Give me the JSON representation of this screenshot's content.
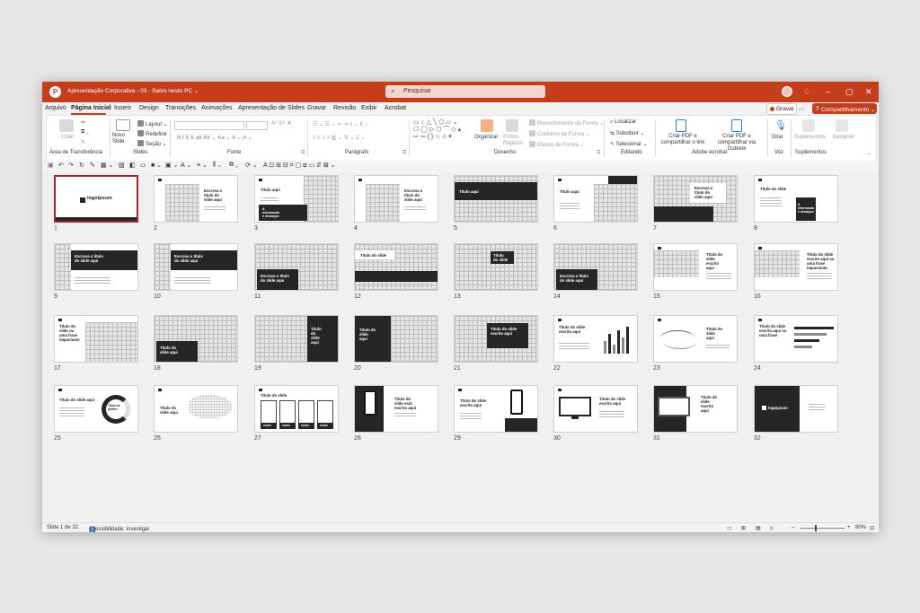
{
  "titlebar": {
    "doc_title": "Apresentação Corporativa - 03  ·  Salvo neste PC ⌄",
    "search_placeholder": "Pesquisar",
    "accent": "#c43e1c"
  },
  "tabs": [
    "Arquivo",
    "Página Inicial",
    "Inserir",
    "Design",
    "Transições",
    "Animações",
    "Apresentação de Slides",
    "Gravar",
    "Revisão",
    "Exibir",
    "Acrobat"
  ],
  "tab_actions": {
    "record": "Gravar",
    "share": "Compartilhamento ⌄"
  },
  "ribbon": {
    "clipboard": {
      "paste": "Colar",
      "label": "Área de Transferência"
    },
    "slides": {
      "new_slide": "Novo Slide",
      "layout": "Layout ⌄",
      "reset": "Redefinir",
      "section": "Seção ⌄",
      "label": "Slides"
    },
    "font": {
      "label": "Fonte",
      "buttons": "N  I  S  S  ab  AV ⌄  Aa ⌄  A ⌄  A ⌄"
    },
    "paragraph": {
      "label": "Parágrafo"
    },
    "drawing": {
      "arrange": "Organizar",
      "quick_styles": "Estilos Rápidos",
      "fill": "Preenchimento da Forma ⌄",
      "outline": "Contorno da Forma ⌄",
      "effects": "Efeitos de Forma ⌄",
      "label": "Desenho"
    },
    "editing": {
      "find": "Localizar",
      "replace": "Substituir ⌄",
      "select": "Selecionar ⌄",
      "label": "Editando"
    },
    "acrobat": {
      "create_share": "Criar PDF e compartilhar o link",
      "create_outlook": "Criar PDF e compartilhar via Outlook",
      "label": "Adobe Acrobat"
    },
    "voice": {
      "dictate": "Ditar",
      "label": "Voz"
    },
    "addins": {
      "suggestions": "Suplementos",
      "designer": "Designer",
      "label": "Suplementos"
    }
  },
  "slides": [
    {
      "n": "1",
      "kind": "cover",
      "logo": "logoipsum"
    },
    {
      "n": "2",
      "kind": "grid-left",
      "title": "Escreva o\ntítulo do\nslide aqui"
    },
    {
      "n": "3",
      "kind": "grid-right-dark",
      "title": "Título aqui",
      "caption": "A\ninformação\né destaque"
    },
    {
      "n": "4",
      "kind": "grid-left",
      "title": "Escreva o\ntítulo do\nslide aqui"
    },
    {
      "n": "5",
      "kind": "dark-top",
      "title": "Título aqui"
    },
    {
      "n": "6",
      "kind": "text-grid",
      "title": "Título aqui"
    },
    {
      "n": "7",
      "kind": "grid-box",
      "title": "Escreva o\ntítulo do\nslide aqui"
    },
    {
      "n": "8",
      "kind": "text-dark",
      "title": "Título do slide",
      "caption": "A\ninformação\né destaque"
    },
    {
      "n": "9",
      "kind": "dark-wide",
      "title": "Escreva o título\ndo slide aqui"
    },
    {
      "n": "10",
      "kind": "dark-wide",
      "title": "Escreva o título\ndo slide aqui"
    },
    {
      "n": "11",
      "kind": "grid-dark-box",
      "title": "Escreva o título\ndo slide aqui"
    },
    {
      "n": "12",
      "kind": "grid-band",
      "title": "Título do slide"
    },
    {
      "n": "13",
      "kind": "grid-box-small",
      "title": "Título\ndo slide"
    },
    {
      "n": "14",
      "kind": "grid-dark-box",
      "title": "Escreva o título\ndo slide aqui"
    },
    {
      "n": "15",
      "kind": "grid-text",
      "title": "Título do\nslide\nescrito\naqui"
    },
    {
      "n": "16",
      "kind": "grid-text",
      "title": "Título do slide\nescrito aqui ou\numa frase\nimpactante."
    },
    {
      "n": "17",
      "kind": "text-grid-left",
      "title": "Título do\nslide ou\numa frase\nimpactante"
    },
    {
      "n": "18",
      "kind": "grid-dark-box",
      "title": "Título do\nslide aqui"
    },
    {
      "n": "19",
      "kind": "grid-dark-right",
      "title": "Título\ndo\nslide\naqui"
    },
    {
      "n": "20",
      "kind": "grid-dark-left",
      "title": "Título do\nslide\naqui"
    },
    {
      "n": "21",
      "kind": "grid-dark-center",
      "title": "Título do slide\nescrito aqui"
    },
    {
      "n": "22",
      "kind": "bars",
      "title": "Título do slide\nescrito aqui"
    },
    {
      "n": "23",
      "kind": "line",
      "title": "Título do\nslide\naqui"
    },
    {
      "n": "24",
      "kind": "hbars",
      "title": "Título do slide\nescrito aqui ou\numa frase"
    },
    {
      "n": "25",
      "kind": "donut",
      "title": "Título do slide aqui",
      "caption": "Título do\ngráfico"
    },
    {
      "n": "26",
      "kind": "map",
      "title": "Título do\nslide aqui"
    },
    {
      "n": "27",
      "kind": "cards",
      "title": "Título do slide",
      "labels": [
        "SEMN",
        "SEMN",
        "SEMN",
        "SEMN"
      ]
    },
    {
      "n": "28",
      "kind": "phone-left",
      "title": "Título do\nslide está\nescrito aqui"
    },
    {
      "n": "29",
      "kind": "phone-right",
      "title": "Título do slide\nescrito aqui"
    },
    {
      "n": "30",
      "kind": "monitor-left",
      "title": "Título do slide\nescrito aqui"
    },
    {
      "n": "31",
      "kind": "monitor-dark",
      "title": "Título do\nslide\nescrito\naqui"
    },
    {
      "n": "32",
      "kind": "end",
      "logo": "logoipsum"
    }
  ],
  "status": {
    "slide_count": "Slide 1 de 32",
    "accessibility": "Acessibilidade: investigar",
    "zoom": "80%"
  }
}
